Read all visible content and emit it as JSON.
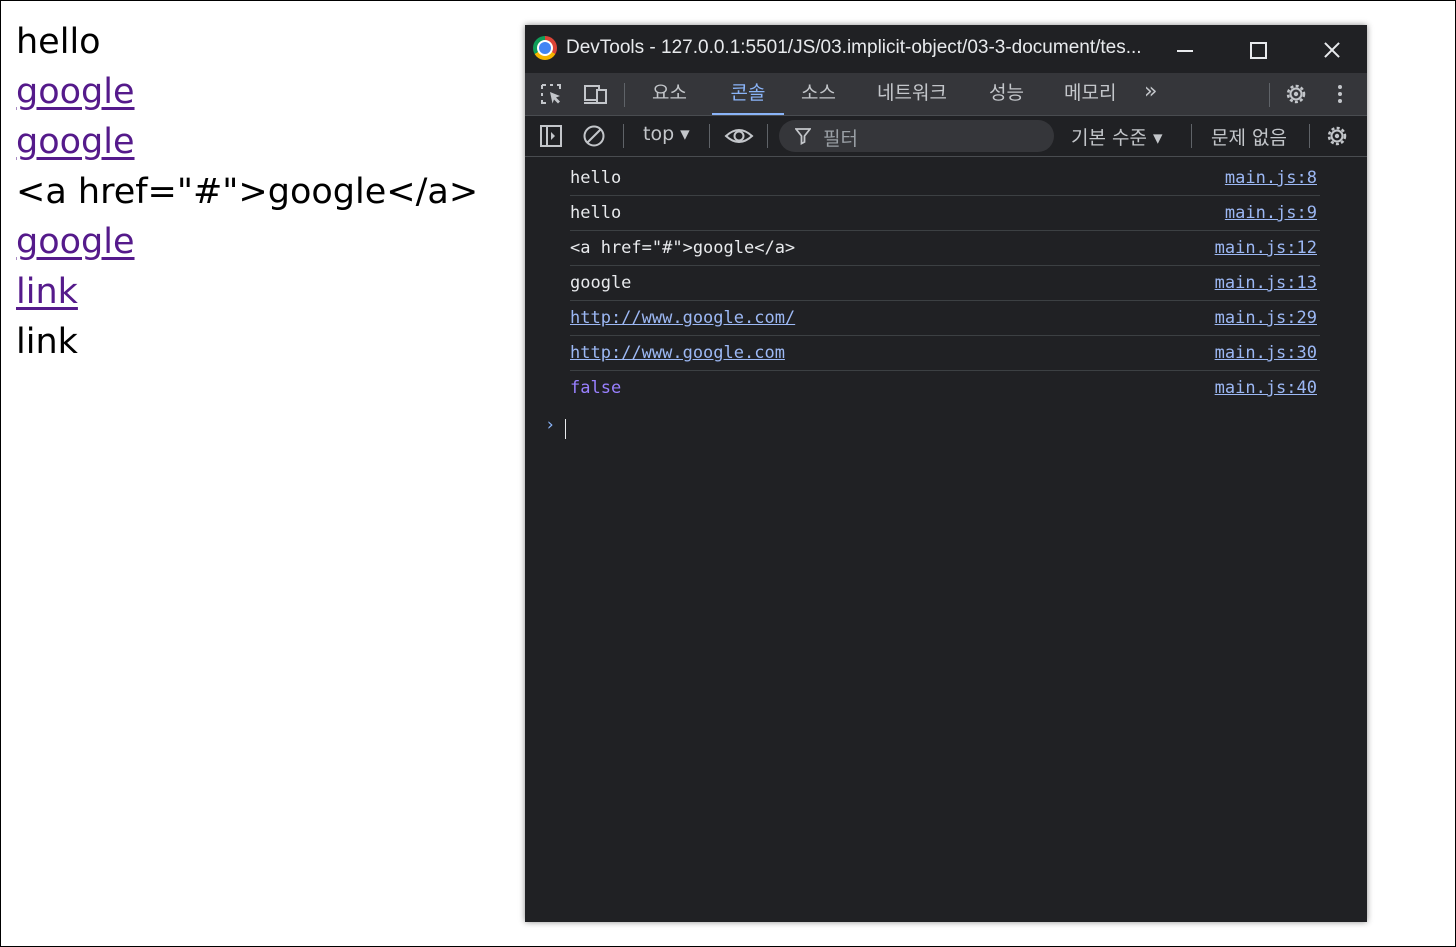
{
  "page": {
    "lines": [
      {
        "text": "hello",
        "kind": "text"
      },
      {
        "text": "google",
        "kind": "link"
      },
      {
        "text": "google",
        "kind": "link"
      },
      {
        "text": "<a href=\"#\">google</a>",
        "kind": "text"
      },
      {
        "text": "google",
        "kind": "link"
      },
      {
        "text": "link",
        "kind": "link"
      },
      {
        "text": "link",
        "kind": "text"
      }
    ]
  },
  "devtools": {
    "title": "DevTools - 127.0.0.1:5501/JS/03.implicit-object/03-3-document/tes...",
    "tabs": [
      "요소",
      "콘솔",
      "소스",
      "네트워크",
      "성능",
      "메모리"
    ],
    "active_tab": "콘솔",
    "toolbar": {
      "context": "top ▾",
      "filter_placeholder": "필터",
      "levels": "기본 수준 ▾",
      "issues": "문제 없음"
    },
    "messages": [
      {
        "text": "hello",
        "source": "main.js:8",
        "type": "text"
      },
      {
        "text": "hello",
        "source": "main.js:9",
        "type": "text"
      },
      {
        "text": "<a href=\"#\">google</a>",
        "source": "main.js:12",
        "type": "text"
      },
      {
        "text": "google",
        "source": "main.js:13",
        "type": "text"
      },
      {
        "text": "http://www.google.com/",
        "source": "main.js:29",
        "type": "url"
      },
      {
        "text": "http://www.google.com",
        "source": "main.js:30",
        "type": "url"
      },
      {
        "text": "false",
        "source": "main.js:40",
        "type": "bool"
      }
    ],
    "prompt": "›"
  },
  "colors": {
    "devtools_bg": "#202124",
    "accent": "#8ab4f8",
    "visited_link": "#551a8b",
    "boolean": "#9980ff"
  }
}
